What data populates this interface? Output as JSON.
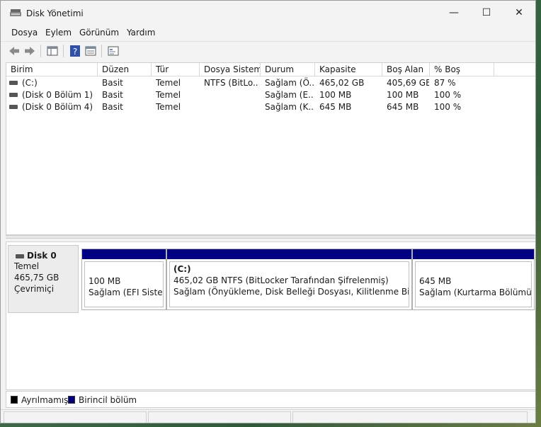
{
  "window": {
    "title": "Disk Yönetimi",
    "controls": [
      "—",
      "☐",
      "✕"
    ]
  },
  "menu": [
    "Dosya",
    "Eylem",
    "Görünüm",
    "Yardım"
  ],
  "toolbar": {
    "icons": [
      "back-icon",
      "forward-icon",
      "console-tree-icon",
      "help-icon",
      "properties-icon",
      "settings-icon"
    ]
  },
  "list": {
    "headers": [
      "Birim",
      "Düzen",
      "Tür",
      "Dosya Sistemi",
      "Durum",
      "Kapasite",
      "Boş Alan",
      "% Boş"
    ],
    "rows": [
      [
        "(C:)",
        "Basit",
        "Temel",
        "NTFS (BitLo...",
        "Sağlam (Ö...",
        "465,02 GB",
        "405,69 GB",
        "87 %"
      ],
      [
        "(Disk 0 Bölüm 1)",
        "Basit",
        "Temel",
        "",
        "Sağlam (E...",
        "100 MB",
        "100 MB",
        "100 %"
      ],
      [
        "(Disk 0 Bölüm 4)",
        "Basit",
        "Temel",
        "",
        "Sağlam (K...",
        "645 MB",
        "645 MB",
        "100 %"
      ]
    ]
  },
  "disk": {
    "name": "Disk 0",
    "type": "Temel",
    "size": "465,75 GB",
    "status": "Çevrimiçi",
    "partitions": [
      {
        "label": "",
        "size": "100 MB",
        "status": "Sağlam (EFI Sistem Bölümü)"
      },
      {
        "label": "(C:)",
        "size": "465,02 GB NTFS (BitLocker Tarafından Şifrelenmiş)",
        "status": "Sağlam (Önyükleme, Disk Belleği Dosyası, Kilitlenme Bilgisi, Temel Veri Bölümü)"
      },
      {
        "label": "",
        "size": "645 MB",
        "status": "Sağlam (Kurtarma Bölümü)"
      }
    ]
  },
  "legend": [
    {
      "label": "Ayrılmamış",
      "color": "#000000"
    },
    {
      "label": "Birincil bölüm",
      "color": "#000080"
    }
  ],
  "colors": {
    "partition_bar": "#000080"
  }
}
